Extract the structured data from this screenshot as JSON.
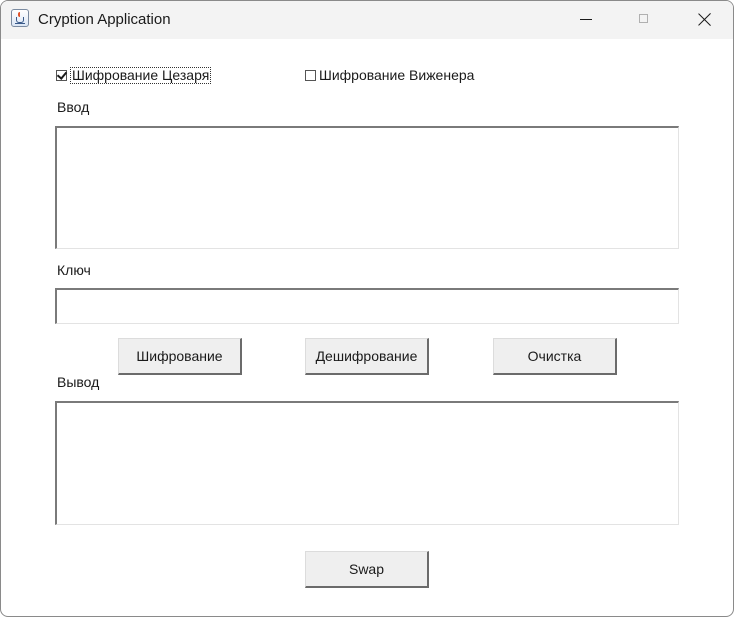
{
  "window": {
    "title": "Cryption Application",
    "icon": "java-cup-icon"
  },
  "options": {
    "caesar": {
      "label": "Шифрование Цезаря",
      "checked": true
    },
    "vigenere": {
      "label": "Шифрование Виженера",
      "checked": false
    }
  },
  "input": {
    "label": "Ввод",
    "value": ""
  },
  "key": {
    "label": "Ключ",
    "value": ""
  },
  "buttons": {
    "encrypt": "Шифрование",
    "decrypt": "Дешифрование",
    "clear": "Очистка",
    "swap": "Swap"
  },
  "output": {
    "label": "Вывод",
    "value": ""
  }
}
